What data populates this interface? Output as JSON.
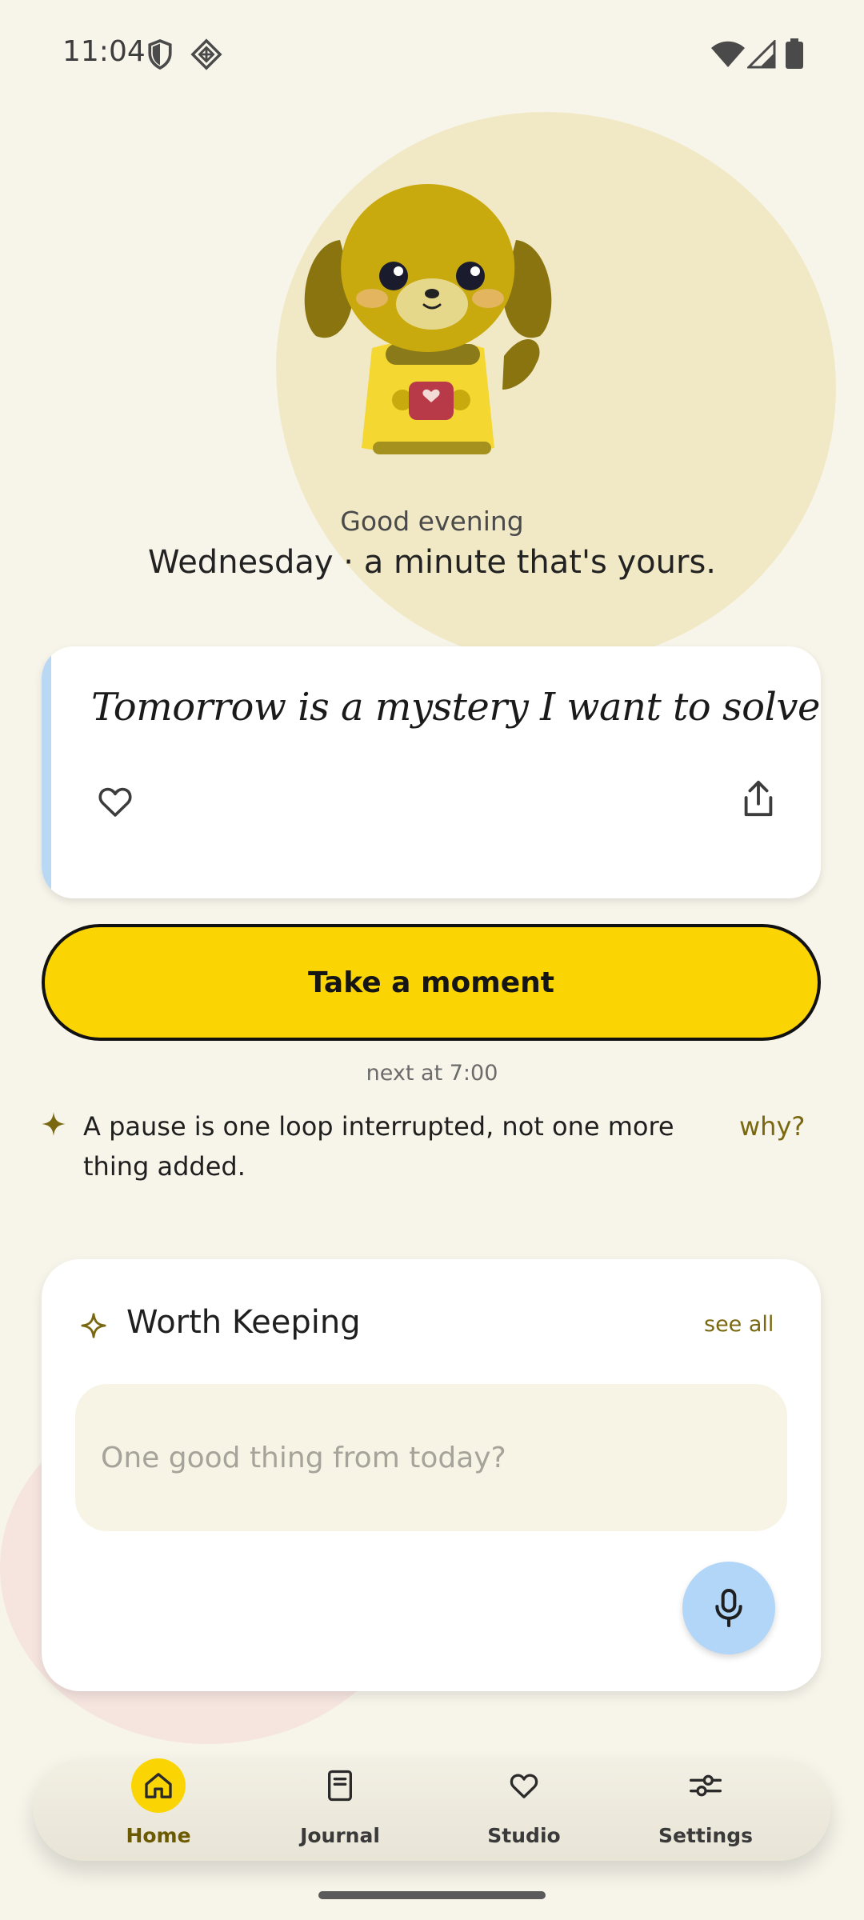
{
  "status_bar": {
    "time": "11:04",
    "icons": [
      "shield-icon",
      "diamond-grid-icon",
      "wifi-icon",
      "signal-icon",
      "battery-icon"
    ]
  },
  "header": {
    "greeting": "Good evening",
    "subgreeting": "Wednesday · a minute that's yours."
  },
  "quote_card": {
    "text": "Tomorrow is a mystery I want to solve.",
    "accent_color": "#b9d8f4",
    "icons": [
      "heart-outline-icon",
      "share-icon"
    ]
  },
  "cta": {
    "label": "Take a moment",
    "next_label": "next at 7:00",
    "color": "#fbd404"
  },
  "tip": {
    "text": "A pause is one loop interrupted, not one more thing added.",
    "why_label": "why?"
  },
  "worth_keeping": {
    "title": "Worth Keeping",
    "see_all_label": "see all",
    "input_placeholder": "One good thing from today?",
    "input_value": "",
    "mic_color": "#b2d6f8"
  },
  "bottom_nav": {
    "items": [
      {
        "label": "Home",
        "icon": "home-icon",
        "active": true
      },
      {
        "label": "Journal",
        "icon": "journal-icon",
        "active": false
      },
      {
        "label": "Studio",
        "icon": "heart-icon",
        "active": false
      },
      {
        "label": "Settings",
        "icon": "sliders-icon",
        "active": false
      }
    ],
    "accent_color": "#fbd404"
  }
}
